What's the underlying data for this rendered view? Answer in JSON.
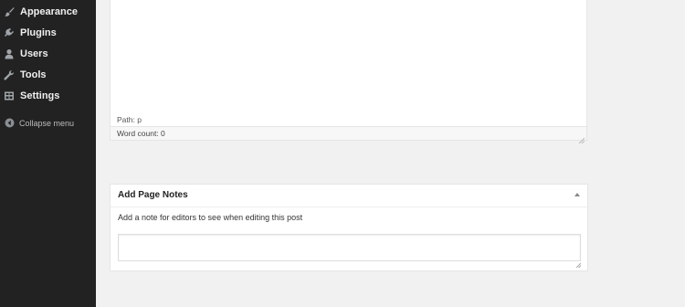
{
  "sidebar": {
    "items": [
      {
        "label": "Appearance",
        "icon": "paintbrush-icon"
      },
      {
        "label": "Plugins",
        "icon": "plug-icon"
      },
      {
        "label": "Users",
        "icon": "user-icon"
      },
      {
        "label": "Tools",
        "icon": "wrench-icon"
      },
      {
        "label": "Settings",
        "icon": "settings-icon"
      }
    ],
    "collapse": {
      "label": "Collapse menu",
      "icon": "collapse-arrow-icon"
    }
  },
  "editor": {
    "path": "Path: p",
    "word_count": "Word count: 0"
  },
  "notes": {
    "title": "Add Page Notes",
    "description": "Add a note for editors to see when editing this post",
    "value": ""
  }
}
